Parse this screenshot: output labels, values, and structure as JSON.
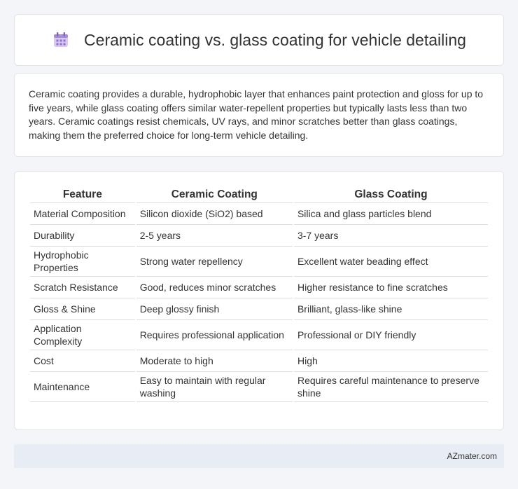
{
  "header": {
    "title": "Ceramic coating vs. glass coating for vehicle detailing",
    "icon": "calendar-icon"
  },
  "summary": {
    "text": "Ceramic coating provides a durable, hydrophobic layer that enhances paint protection and gloss for up to five years, while glass coating offers similar water-repellent properties but typically lasts less than two years. Ceramic coatings resist chemicals, UV rays, and minor scratches better than glass coatings, making them the preferred choice for long-term vehicle detailing."
  },
  "table": {
    "headers": [
      "Feature",
      "Ceramic Coating",
      "Glass Coating"
    ],
    "rows": [
      [
        "Material Composition",
        "Silicon dioxide (SiO2) based",
        "Silica and glass particles blend"
      ],
      [
        "Durability",
        "2-5 years",
        "3-7 years"
      ],
      [
        "Hydrophobic Properties",
        "Strong water repellency",
        "Excellent water beading effect"
      ],
      [
        "Scratch Resistance",
        "Good, reduces minor scratches",
        "Higher resistance to fine scratches"
      ],
      [
        "Gloss & Shine",
        "Deep glossy finish",
        "Brilliant, glass-like shine"
      ],
      [
        "Application Complexity",
        "Requires professional application",
        "Professional or DIY friendly"
      ],
      [
        "Cost",
        "Moderate to high",
        "High"
      ],
      [
        "Maintenance",
        "Easy to maintain with regular washing",
        "Requires careful maintenance to preserve shine"
      ]
    ]
  },
  "footer": {
    "brand": "AZmater.com"
  }
}
